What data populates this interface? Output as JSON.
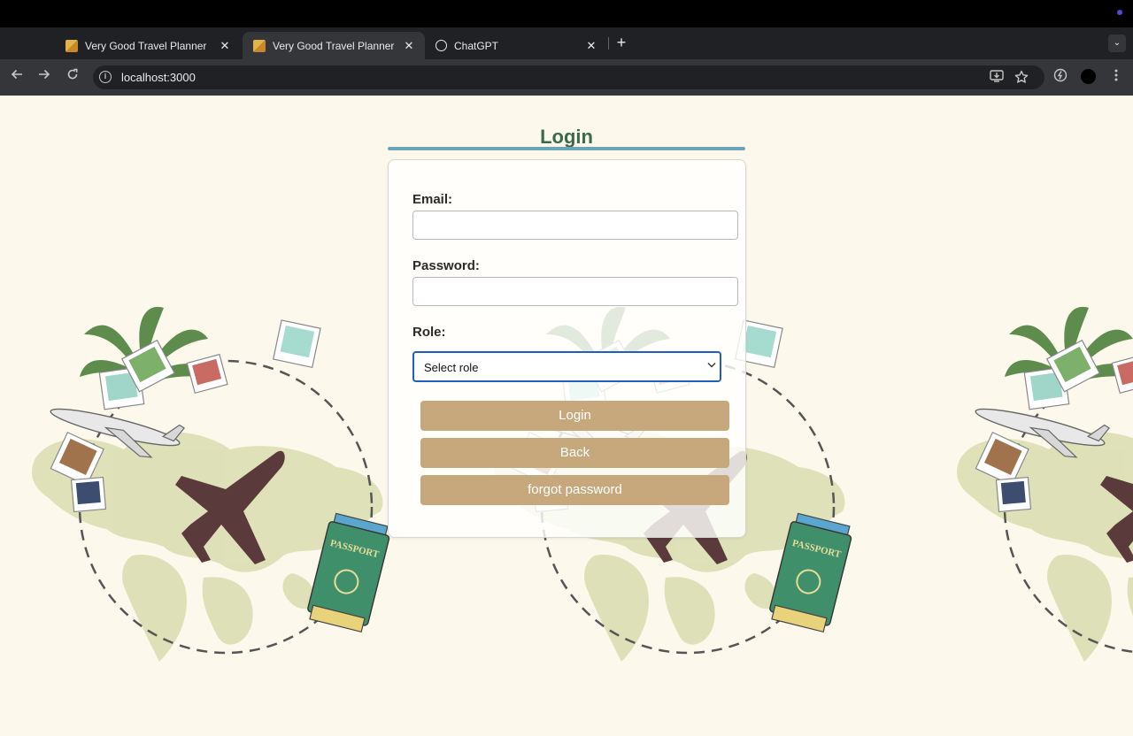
{
  "browser": {
    "tabs": [
      {
        "title": "Very Good Travel Planner",
        "close": "✕",
        "active": false
      },
      {
        "title": "Very Good Travel Planner",
        "close": "✕",
        "active": true
      },
      {
        "title": "ChatGPT",
        "close": "✕",
        "active": false
      }
    ],
    "new_tab": "+",
    "tab_menu": "⌄",
    "url": "localhost:3000",
    "info_glyph": "i"
  },
  "login": {
    "heading": "Login",
    "email_label": "Email:",
    "email_value": "",
    "password_label": "Password:",
    "password_value": "",
    "role_label": "Role:",
    "role_selected": "Select role",
    "buttons": {
      "login": "Login",
      "back": "Back",
      "forgot": "forgot password"
    }
  },
  "colors": {
    "page_bg": "#fcf8ec",
    "heading": "#3a6b4a",
    "heading_rule": "#6ba6b7",
    "button": "#c7a77c",
    "select_focus": "#1f5fbf"
  },
  "icons": [
    "back-arrow-icon",
    "forward-arrow-icon",
    "reload-icon",
    "info-icon",
    "install-app-icon",
    "bookmark-star-icon",
    "extension-icon",
    "profile-avatar",
    "more-menu-icon",
    "airplane-icon",
    "passport-icon",
    "palm-leaves-icon",
    "photo-icon",
    "world-map-icon"
  ]
}
